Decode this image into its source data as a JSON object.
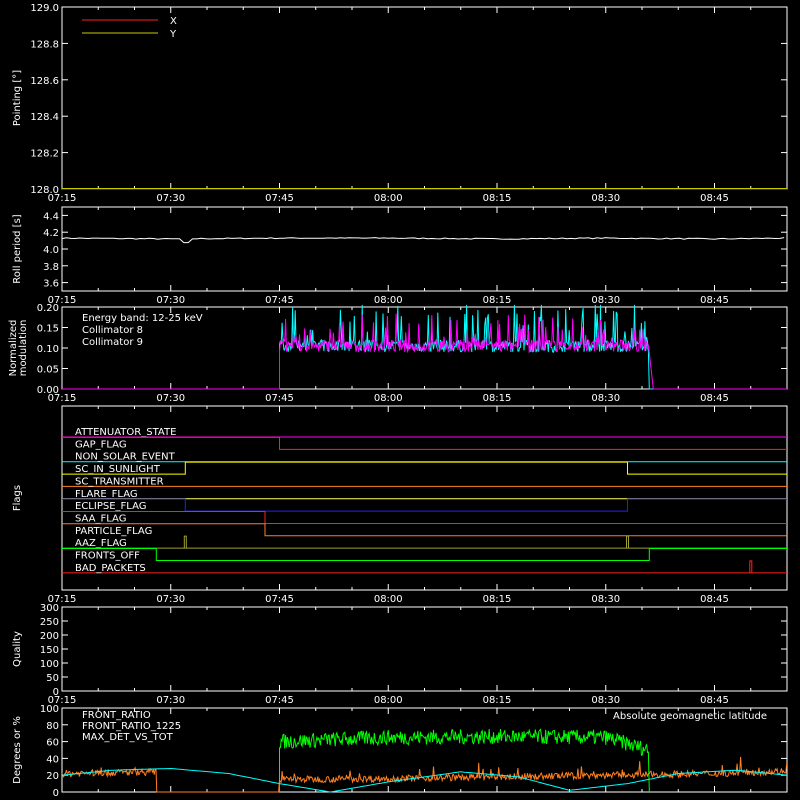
{
  "x_ticks": [
    "07:15",
    "07:30",
    "07:45",
    "08:00",
    "08:15",
    "08:30",
    "08:45"
  ],
  "colors": {
    "red": "#ff2020",
    "yellow": "#c8c800",
    "white": "#ffffff",
    "cyan": "#00ffff",
    "magenta": "#ff00ff",
    "orange": "#ff8020",
    "green": "#00ff00",
    "blue": "#2020ff",
    "olive": "#a0a030"
  },
  "chart_data": [
    {
      "type": "line",
      "ylabel": "Pointing [°]",
      "ylim": [
        128.0,
        129.0
      ],
      "yticks": [
        "128.0",
        "128.2",
        "128.4",
        "128.6",
        "128.8",
        "129.0"
      ],
      "legend": {
        "placement": "top-left",
        "entries": [
          {
            "name": "X",
            "color": "#ff2020"
          },
          {
            "name": "Y",
            "color": "#c8c800"
          }
        ]
      },
      "series": [
        {
          "name": "X",
          "color": "#ff2020",
          "x": [
            "07:15",
            "08:55"
          ],
          "values": [
            128.0,
            128.0
          ]
        },
        {
          "name": "Y",
          "color": "#c8c800",
          "x": [
            "07:15",
            "08:55"
          ],
          "values": [
            128.0,
            128.0
          ]
        }
      ]
    },
    {
      "type": "line",
      "ylabel": "Roll period [s]",
      "ylim": [
        3.5,
        4.5
      ],
      "yticks": [
        "3.6",
        "3.8",
        "4.0",
        "4.2",
        "4.4"
      ],
      "series": [
        {
          "color": "#ffffff",
          "x": [
            "07:15",
            "07:30",
            "07:45",
            "08:00",
            "08:15",
            "08:30",
            "08:45",
            "08:55"
          ],
          "values": [
            4.13,
            4.12,
            4.13,
            4.13,
            4.12,
            4.13,
            4.12,
            4.13
          ]
        }
      ]
    },
    {
      "type": "line",
      "ylabel": "Normalized modulation",
      "ylim": [
        0,
        0.2
      ],
      "yticks": [
        "0.00",
        "0.05",
        "0.10",
        "0.15",
        "0.20"
      ],
      "annotation": "Energy band: 12-25 keV",
      "legend": {
        "placement": "top-left",
        "entries": [
          {
            "name": "Collimator 8",
            "color": "#00ffff"
          },
          {
            "name": "Collimator 9",
            "color": "#ff00ff"
          }
        ]
      },
      "active_interval": [
        "07:45",
        "08:36"
      ],
      "baseline": 0.09,
      "series": [
        {
          "name": "Collimator 8",
          "color": "#00ffff",
          "x": [
            "07:45",
            "08:00",
            "08:15",
            "08:30",
            "08:36"
          ],
          "values": [
            0.11,
            0.12,
            0.12,
            0.11,
            0.1
          ]
        },
        {
          "name": "Collimator 9",
          "color": "#ff00ff",
          "x": [
            "07:45",
            "08:00",
            "08:15",
            "08:30",
            "08:36"
          ],
          "values": [
            0.1,
            0.11,
            0.11,
            0.1,
            0.09
          ]
        }
      ]
    },
    {
      "type": "line",
      "ylabel": "Flags",
      "flags": [
        {
          "name": "ATTENUATOR_STATE",
          "color": "#ff00ff",
          "segments": [
            [
              "07:15",
              "08:55",
              0
            ]
          ]
        },
        {
          "name": "GAP_FLAG",
          "color": "#ff2020",
          "segments": [
            [
              "07:15",
              "07:45",
              1
            ],
            [
              "07:45",
              "08:55",
              0
            ]
          ]
        },
        {
          "name": "NON_SOLAR_EVENT",
          "color": "#00ffff",
          "segments": [
            [
              "07:15",
              "08:55",
              0
            ]
          ]
        },
        {
          "name": "SC_IN_SUNLIGHT",
          "color": "#ffff00",
          "segments": [
            [
              "07:15",
              "07:32",
              0
            ],
            [
              "07:32",
              "08:33",
              1
            ],
            [
              "08:33",
              "08:55",
              0
            ]
          ]
        },
        {
          "name": "SC_TRANSMITTER",
          "color": "#ff8020",
          "segments": [
            [
              "07:15",
              "08:55",
              0
            ]
          ]
        },
        {
          "name": "FLARE_FLAG",
          "color": "#ffff60",
          "segments": [
            [
              "07:15",
              "08:55",
              0
            ]
          ]
        },
        {
          "name": "ECLIPSE_FLAG",
          "color": "#2020ff",
          "segments": [
            [
              "07:15",
              "07:32",
              1
            ],
            [
              "07:32",
              "08:33",
              0
            ],
            [
              "08:33",
              "08:55",
              1
            ]
          ]
        },
        {
          "name": "SAA_FLAG",
          "color": "#ff2020",
          "segments": [
            [
              "07:15",
              "07:43",
              1
            ],
            [
              "07:43",
              "08:55",
              0
            ]
          ]
        },
        {
          "name": "PARTICLE_FLAG",
          "color": "#ff8020",
          "segments": [
            [
              "07:15",
              "07:43",
              1
            ],
            [
              "07:43",
              "08:55",
              0
            ]
          ]
        },
        {
          "name": "AAZ_FLAG",
          "color": "#a0a030",
          "segments": [
            [
              "07:15",
              "07:32",
              0
            ],
            [
              "07:32",
              "07:32",
              1
            ],
            [
              "07:32",
              "08:33",
              0
            ],
            [
              "08:33",
              "08:33",
              1
            ],
            [
              "08:33",
              "08:55",
              0
            ]
          ]
        },
        {
          "name": "FRONTS_OFF",
          "color": "#00ff00",
          "segments": [
            [
              "07:15",
              "07:28",
              1
            ],
            [
              "07:28",
              "08:36",
              0
            ],
            [
              "08:36",
              "08:55",
              1
            ]
          ]
        },
        {
          "name": "BAD_PACKETS",
          "color": "#ff2020",
          "segments": [
            [
              "07:15",
              "08:50",
              0
            ],
            [
              "08:50",
              "08:50",
              1
            ],
            [
              "08:50",
              "08:55",
              0
            ]
          ]
        }
      ]
    },
    {
      "type": "line",
      "ylabel": "Quality",
      "ylim": [
        0,
        300
      ],
      "yticks": [
        "0",
        "50",
        "100",
        "150",
        "200",
        "250",
        "300"
      ],
      "series": [
        {
          "color": "#ffffff",
          "x": [
            "07:15",
            "08:55"
          ],
          "values": [
            0,
            0
          ]
        }
      ]
    },
    {
      "type": "line",
      "ylabel": "Degrees or %",
      "ylim": [
        0,
        100
      ],
      "yticks": [
        "0",
        "20",
        "40",
        "60",
        "80",
        "100"
      ],
      "legend": {
        "placement": "top-left",
        "entries": [
          {
            "name": "FRONT_RATIO",
            "color": "#ffff00"
          },
          {
            "name": "FRONT_RATIO_1225",
            "color": "#00ff00"
          },
          {
            "name": "MAX_DET_VS_TOT",
            "color": "#ff8020"
          }
        ]
      },
      "annotation": "Absolute geomagnetic latitude",
      "annotation_color": "#00ffff",
      "series": [
        {
          "name": "FRONT_RATIO_1225",
          "color": "#00ff00",
          "x": [
            "07:45",
            "08:00",
            "08:15",
            "08:30",
            "08:36"
          ],
          "values": [
            60,
            65,
            66,
            65,
            50
          ]
        },
        {
          "name": "MAX_DET_VS_TOT",
          "color": "#ff8020",
          "x": [
            "07:15",
            "07:28",
            "07:45",
            "08:00",
            "08:15",
            "08:30",
            "08:45",
            "08:55"
          ],
          "values": [
            22,
            24,
            15,
            16,
            18,
            20,
            22,
            25
          ]
        },
        {
          "name": "Absolute geomagnetic latitude",
          "color": "#00ffff",
          "x": [
            "07:15",
            "07:22",
            "07:30",
            "07:38",
            "07:45",
            "07:52",
            "08:00",
            "08:10",
            "08:18",
            "08:25",
            "08:33",
            "08:40",
            "08:48",
            "08:55"
          ],
          "values": [
            20,
            26,
            28,
            22,
            10,
            0,
            12,
            24,
            18,
            2,
            10,
            22,
            26,
            20
          ]
        }
      ]
    }
  ]
}
